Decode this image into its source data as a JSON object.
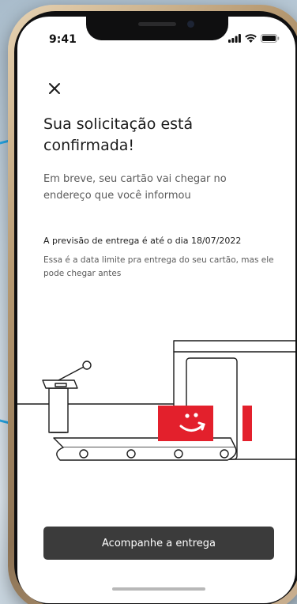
{
  "status_bar": {
    "time": "9:41"
  },
  "header": {
    "close_icon": "close-icon"
  },
  "content": {
    "title": "Sua solicitação está confirmada!",
    "subtitle": "Em breve, seu cartão vai chegar no endereço que você informou",
    "delivery_forecast": "A previsão de entrega é até o dia 18/07/2022",
    "delivery_note": "Essa é a data limite pra entrega do seu cartão, mas ele pode chegar antes"
  },
  "footer": {
    "cta_label": "Acompanhe a entrega"
  },
  "colors": {
    "accent": "#e3202c",
    "button": "#3b3b3b",
    "text": "#1b1b1b",
    "muted": "#5b5b5b"
  }
}
